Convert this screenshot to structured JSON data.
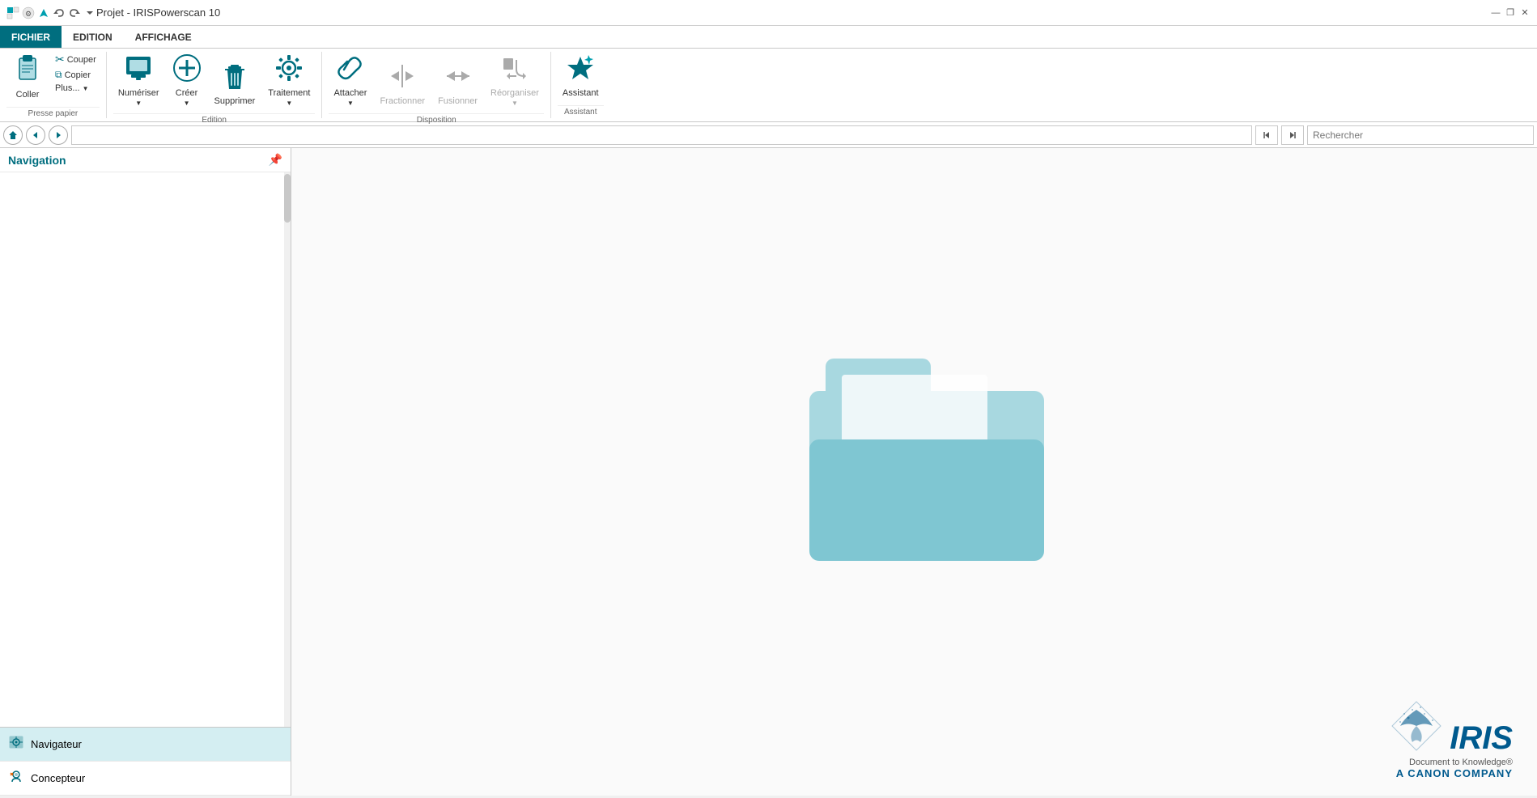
{
  "titlebar": {
    "title": "Projet - IRISPowerscan 10",
    "minimize": "—",
    "maximize": "❐",
    "close": "✕"
  },
  "ribbon": {
    "tabs": [
      {
        "id": "fichier",
        "label": "FICHIER",
        "active": true
      },
      {
        "id": "edition",
        "label": "EDITION",
        "active": false
      },
      {
        "id": "affichage",
        "label": "AFFICHAGE",
        "active": false
      }
    ],
    "groups": {
      "presse_papier": {
        "label": "Presse papier",
        "coller": "Coller",
        "couper": "Couper",
        "copier": "Copier",
        "plus": "Plus..."
      },
      "edition": {
        "label": "Edition",
        "numeriser": "Numériser",
        "creer": "Créer",
        "supprimer": "Supprimer",
        "traitement": "Traitement"
      },
      "disposition": {
        "label": "Disposition",
        "attacher": "Attacher",
        "fractionner": "Fractionner",
        "fusionner": "Fusionner",
        "reorganiser": "Réorganiser"
      },
      "assistant": {
        "label": "Assistant",
        "assistant": "Assistant"
      }
    }
  },
  "navbar": {
    "search_placeholder": "Rechercher"
  },
  "left_panel": {
    "title": "Navigation",
    "tabs": [
      {
        "id": "navigateur",
        "label": "Navigateur",
        "active": true
      },
      {
        "id": "concepteur",
        "label": "Concepteur",
        "active": false
      }
    ]
  },
  "iris_logo": {
    "iris": "IRIS",
    "document_to_knowledge": "Document to Knowledge®",
    "canon_company": "A CANON COMPANY"
  }
}
